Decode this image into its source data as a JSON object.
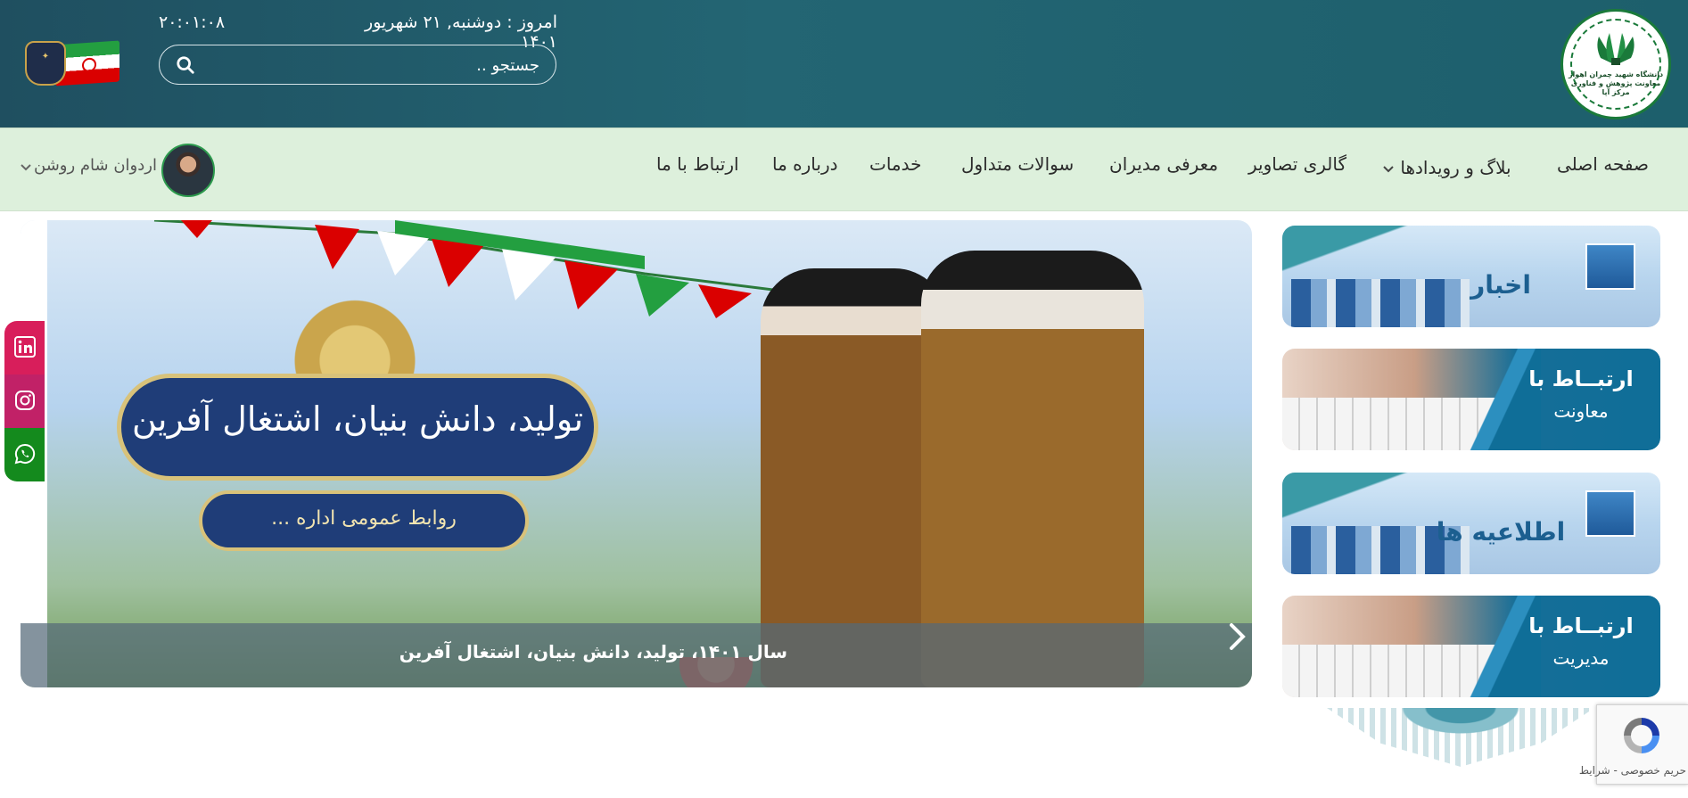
{
  "header": {
    "date_text": "امروز : دوشنبه, ۲۱ شهریور ۱۴۰۱",
    "clock": "۲۰:۰۱:۰۸",
    "logo": {
      "text": "دانشگاه شهید چمران اهواز معاونت پژوهش و فناوری مرکز آپا"
    },
    "search": {
      "placeholder": "جستجو .."
    }
  },
  "nav": {
    "items": [
      {
        "label": "صفحه اصلی"
      },
      {
        "label": "بلاگ و رویدادها"
      },
      {
        "label": "گالری تصاویر"
      },
      {
        "label": "معرفی مدیران"
      },
      {
        "label": "سوالات متداول"
      },
      {
        "label": "خدمات"
      },
      {
        "label": "درباره ما"
      },
      {
        "label": "ارتباط با ما"
      }
    ],
    "user_name": "اردوان شام روشن"
  },
  "slider": {
    "banner_title": "تولید، دانش بنیان، اشتغال آفرین",
    "banner_subtitle": "روابط عمومی اداره ...",
    "caption": "سال ۱۴۰۱، تولید، دانش بنیان، اشتغال آفرین"
  },
  "cards": [
    {
      "label": "اخبار"
    },
    {
      "title": "ارتبــاط با",
      "subtitle": "معاونت"
    },
    {
      "label": "اطلاعیه ها"
    },
    {
      "title": "ارتبــاط با",
      "subtitle": "مدیریت"
    }
  ],
  "recaptcha": {
    "text": "حریم خصوصی - شرایط"
  },
  "colors": {
    "header_bg": "#1f5a68",
    "nav_bg": "#ddf0dc",
    "caption_bg": "#556978",
    "linkedin": "#d81e5b",
    "instagram": "#c12167",
    "whatsapp": "#148a1d",
    "card_blue": "#0f6e98"
  },
  "icons": [
    "search-icon",
    "chevron-down-icon",
    "next-arrow-icon",
    "linkedin-icon",
    "instagram-icon",
    "whatsapp-icon",
    "recaptcha-icon"
  ]
}
